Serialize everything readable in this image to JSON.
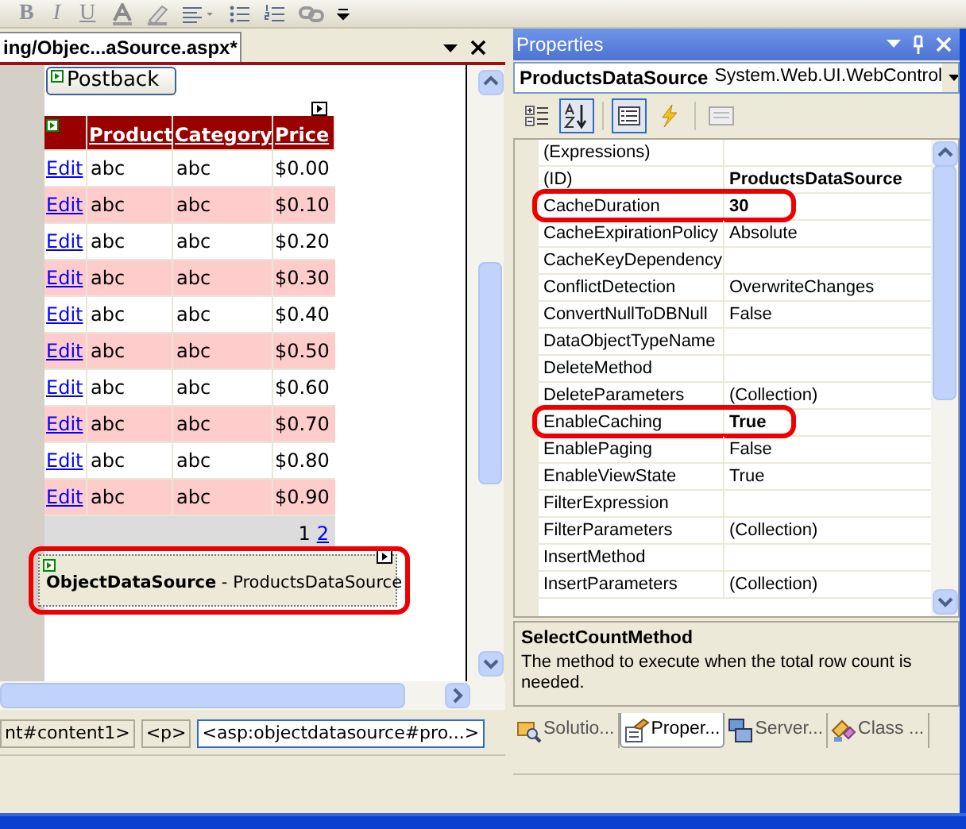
{
  "toolbar": {
    "items": [
      {
        "kind": "text",
        "label": "B"
      },
      {
        "kind": "text",
        "label": "I"
      },
      {
        "kind": "text",
        "label": "U"
      },
      {
        "kind": "icon"
      },
      {
        "kind": "icon"
      },
      {
        "kind": "icon"
      },
      {
        "kind": "icon"
      },
      {
        "kind": "icon"
      },
      {
        "kind": "icon"
      }
    ]
  },
  "document": {
    "tab": {
      "label": "ing/Objec...aSource.aspx*",
      "selected": true
    },
    "postback_button": "Postback",
    "grid": {
      "columns": [
        "",
        "Product",
        "Category",
        "Price"
      ],
      "rows": [
        {
          "edit": "Edit",
          "product": "abc",
          "category": "abc",
          "price": "$0.00",
          "alternate": false
        },
        {
          "edit": "Edit",
          "product": "abc",
          "category": "abc",
          "price": "$0.10",
          "alternate": true
        },
        {
          "edit": "Edit",
          "product": "abc",
          "category": "abc",
          "price": "$0.20",
          "alternate": false
        },
        {
          "edit": "Edit",
          "product": "abc",
          "category": "abc",
          "price": "$0.30",
          "alternate": true
        },
        {
          "edit": "Edit",
          "product": "abc",
          "category": "abc",
          "price": "$0.40",
          "alternate": false
        },
        {
          "edit": "Edit",
          "product": "abc",
          "category": "abc",
          "price": "$0.50",
          "alternate": true
        },
        {
          "edit": "Edit",
          "product": "abc",
          "category": "abc",
          "price": "$0.60",
          "alternate": false
        },
        {
          "edit": "Edit",
          "product": "abc",
          "category": "abc",
          "price": "$0.70",
          "alternate": true
        },
        {
          "edit": "Edit",
          "product": "abc",
          "category": "abc",
          "price": "$0.80",
          "alternate": false
        },
        {
          "edit": "Edit",
          "product": "abc",
          "category": "abc",
          "price": "$0.90",
          "alternate": true
        }
      ],
      "pager": [
        {
          "label": "1",
          "selected": true
        },
        {
          "label": "2",
          "selected": false
        }
      ]
    },
    "data_source": {
      "type": "ObjectDataSource",
      "separator": " - ",
      "name": "ProductsDataSource",
      "highlighted": true
    },
    "tag_path": [
      {
        "label": "nt#content1>",
        "selected": false
      },
      {
        "label": "<p>",
        "selected": false
      },
      {
        "label": "<asp:objectdatasource#pro...>",
        "selected": true
      }
    ]
  },
  "properties": {
    "title": "Properties",
    "object_name": "ProductsDataSource",
    "object_type": "System.Web.UI.WebControl",
    "toolbar": [
      {
        "selected": false
      },
      {
        "selected": true
      },
      {
        "selected": true
      },
      {
        "selected": false
      },
      {
        "selected": false
      }
    ],
    "rows": [
      {
        "name": "(Expressions)",
        "value": "",
        "highlighted": false
      },
      {
        "name": "(ID)",
        "value": "ProductsDataSource",
        "bold": true,
        "highlighted": false
      },
      {
        "name": "CacheDuration",
        "value": "30",
        "bold": true,
        "highlighted": true
      },
      {
        "name": "CacheExpirationPolicy",
        "value": "Absolute",
        "bold": false,
        "highlighted": false
      },
      {
        "name": "CacheKeyDependency",
        "value": "",
        "highlighted": false
      },
      {
        "name": "ConflictDetection",
        "value": "OverwriteChanges",
        "bold": false,
        "highlighted": false
      },
      {
        "name": "ConvertNullToDBNull",
        "value": "False",
        "bold": false,
        "highlighted": false
      },
      {
        "name": "DataObjectTypeName",
        "value": "",
        "highlighted": false
      },
      {
        "name": "DeleteMethod",
        "value": "",
        "highlighted": false
      },
      {
        "name": "DeleteParameters",
        "value": "(Collection)",
        "bold": false,
        "highlighted": false
      },
      {
        "name": "EnableCaching",
        "value": "True",
        "bold": true,
        "highlighted": true
      },
      {
        "name": "EnablePaging",
        "value": "False",
        "bold": false,
        "highlighted": false
      },
      {
        "name": "EnableViewState",
        "value": "True",
        "bold": false,
        "highlighted": false
      },
      {
        "name": "FilterExpression",
        "value": "",
        "highlighted": false
      },
      {
        "name": "FilterParameters",
        "value": "(Collection)",
        "bold": false,
        "highlighted": false
      },
      {
        "name": "InsertMethod",
        "value": "",
        "highlighted": false
      },
      {
        "name": "InsertParameters",
        "value": "(Collection)",
        "bold": false,
        "highlighted": false
      }
    ],
    "description": {
      "title": "SelectCountMethod",
      "text": "The method to execute when the total row count is needed."
    },
    "tabs": [
      {
        "label": "Solutio...",
        "selected": false
      },
      {
        "label": "Proper...",
        "selected": true
      },
      {
        "label": "Server...",
        "selected": false
      },
      {
        "label": "Class ...",
        "selected": false
      }
    ]
  }
}
